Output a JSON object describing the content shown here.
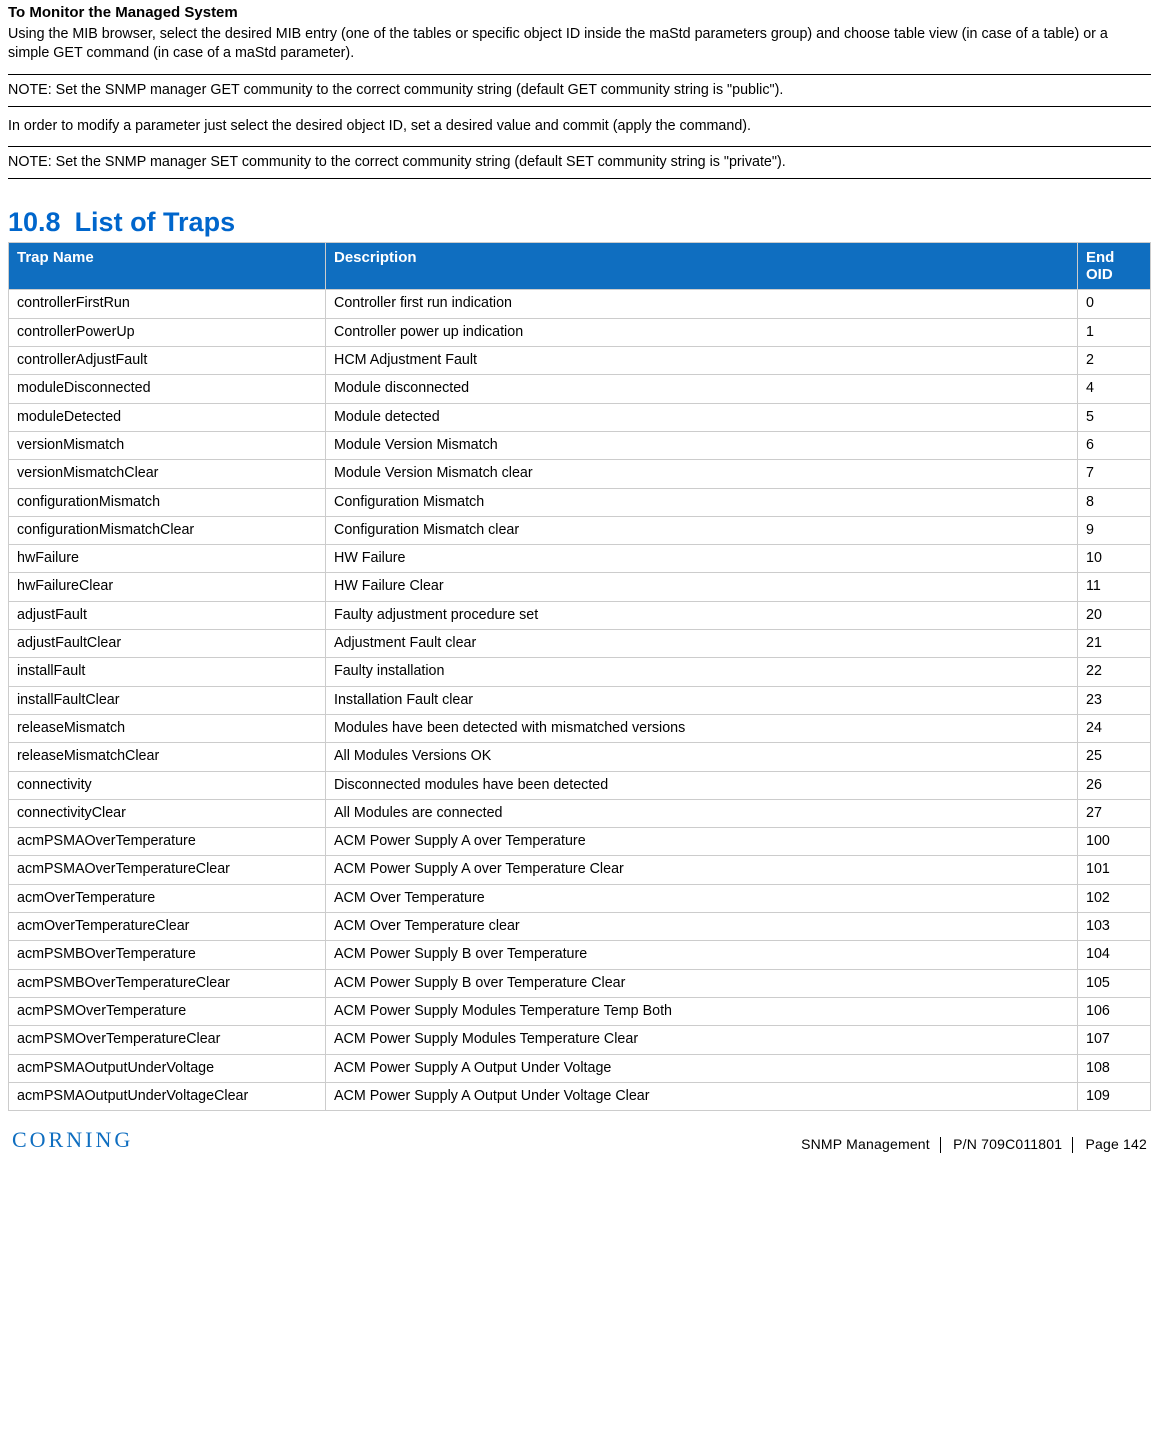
{
  "heading_sub": "To Monitor the Managed System",
  "intro_para": "Using the MIB browser, select the desired MIB entry (one of the tables or specific object ID inside the maStd parameters group) and choose table view (in case of a table) or a simple GET command (in case of a maStd parameter).",
  "note1": "NOTE: Set the SNMP manager GET community to the correct community string (default GET community string is \"public\").",
  "mid_para": "In order to modify a parameter just select the desired object ID, set a desired value and commit (apply the command).",
  "note2": "NOTE: Set the SNMP manager SET community to the correct community string (default SET community string is \"private\").",
  "section_number": "10.8",
  "section_title": "List of Traps",
  "columns": {
    "name": "Trap Name",
    "desc": "Description",
    "oid": "End OID"
  },
  "rows": [
    {
      "name": "controllerFirstRun",
      "desc": "Controller first run indication",
      "oid": "0"
    },
    {
      "name": "controllerPowerUp",
      "desc": "Controller power up indication",
      "oid": "1"
    },
    {
      "name": "controllerAdjustFault",
      "desc": "HCM Adjustment Fault",
      "oid": "2"
    },
    {
      "name": "moduleDisconnected",
      "desc": "Module disconnected",
      "oid": "4"
    },
    {
      "name": "moduleDetected",
      "desc": "Module detected",
      "oid": "5"
    },
    {
      "name": "versionMismatch",
      "desc": "Module Version Mismatch",
      "oid": "6"
    },
    {
      "name": "versionMismatchClear",
      "desc": "Module Version Mismatch clear",
      "oid": "7"
    },
    {
      "name": "configurationMismatch",
      "desc": "Configuration Mismatch",
      "oid": "8"
    },
    {
      "name": "configurationMismatchClear",
      "desc": "Configuration Mismatch clear",
      "oid": "9"
    },
    {
      "name": "hwFailure",
      "desc": "HW Failure",
      "oid": "10"
    },
    {
      "name": "hwFailureClear",
      "desc": "HW Failure Clear",
      "oid": "11"
    },
    {
      "name": "adjustFault",
      "desc": "Faulty adjustment procedure set",
      "oid": "20"
    },
    {
      "name": "adjustFaultClear",
      "desc": "Adjustment Fault clear",
      "oid": "21"
    },
    {
      "name": "installFault",
      "desc": "Faulty installation",
      "oid": "22"
    },
    {
      "name": "installFaultClear",
      "desc": "Installation Fault clear",
      "oid": "23"
    },
    {
      "name": "releaseMismatch",
      "desc": "Modules have been detected with mismatched versions",
      "oid": "24"
    },
    {
      "name": "releaseMismatchClear",
      "desc": "All Modules Versions OK",
      "oid": "25"
    },
    {
      "name": "connectivity",
      "desc": "Disconnected modules have been detected",
      "oid": "26"
    },
    {
      "name": "connectivityClear",
      "desc": "All Modules are connected",
      "oid": "27"
    },
    {
      "name": "acmPSMAOverTemperature",
      "desc": "ACM Power Supply A over Temperature",
      "oid": "100"
    },
    {
      "name": "acmPSMAOverTemperatureClear",
      "desc": "ACM Power Supply A over Temperature Clear",
      "oid": "101"
    },
    {
      "name": "acmOverTemperature",
      "desc": "ACM Over Temperature",
      "oid": "102"
    },
    {
      "name": "acmOverTemperatureClear",
      "desc": "ACM   Over Temperature clear",
      "oid": "103"
    },
    {
      "name": "acmPSMBOverTemperature",
      "desc": "ACM Power Supply B over Temperature",
      "oid": "104"
    },
    {
      "name": "acmPSMBOverTemperatureClear",
      "desc": "ACM Power Supply B over Temperature Clear",
      "oid": "105"
    },
    {
      "name": "acmPSMOverTemperature",
      "desc": "ACM Power Supply Modules Temperature Temp Both",
      "oid": "106"
    },
    {
      "name": "acmPSMOverTemperatureClear",
      "desc": "ACM Power Supply Modules Temperature Clear",
      "oid": "107"
    },
    {
      "name": "acmPSMAOutputUnderVoltage",
      "desc": "ACM Power Supply A Output Under Voltage",
      "oid": "108"
    },
    {
      "name": "acmPSMAOutputUnderVoltageClear",
      "desc": "ACM Power Supply A Output Under Voltage Clear",
      "oid": "109"
    }
  ],
  "footer": {
    "brand": "CORNING",
    "left": "SNMP Management",
    "mid": "P/N 709C011801",
    "right": "Page 142"
  }
}
